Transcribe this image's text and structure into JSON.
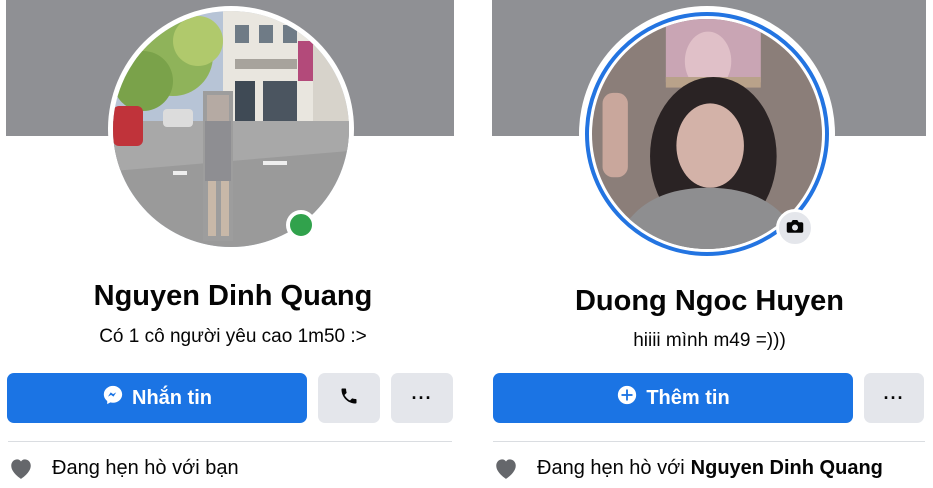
{
  "left_profile": {
    "name": "Nguyen Dinh Quang",
    "bio": "Có 1 cô người yêu cao 1m50 :>",
    "message_button": "Nhắn tin",
    "more_button": "···",
    "relationship_text": "Đang hẹn hò với bạn",
    "online": true,
    "icons": {
      "message": "messenger-icon",
      "call": "phone-icon",
      "relationship": "heart-icon"
    }
  },
  "right_profile": {
    "name": "Duong Ngoc Huyen",
    "bio": "hiiii mình m49 =)))",
    "add_story_button": "Thêm tin",
    "more_button": "···",
    "relationship_prefix": "Đang hẹn hò với",
    "relationship_partner": "Nguyen Dinh Quang",
    "icons": {
      "add": "plus-circle-icon",
      "camera": "camera-icon",
      "relationship": "heart-icon"
    }
  },
  "colors": {
    "primary_button": "#1b74e4",
    "secondary_button": "#e4e6eb",
    "cover": "#8f9094",
    "online": "#31a24c",
    "story_ring": "#2374e1"
  }
}
